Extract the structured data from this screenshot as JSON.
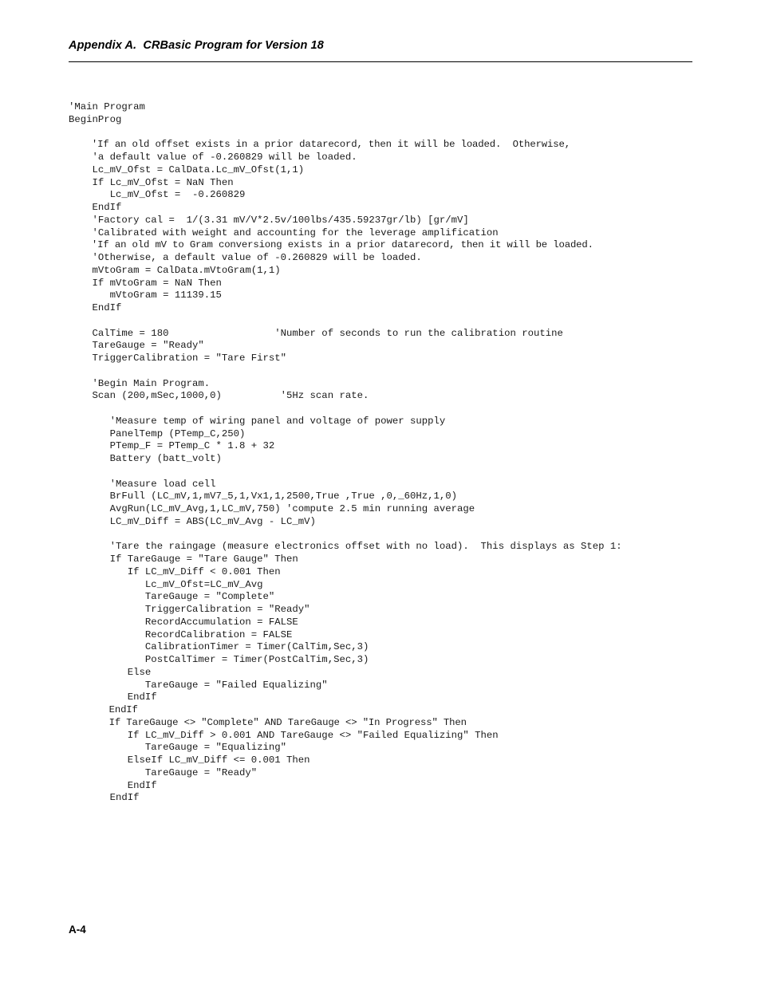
{
  "document": {
    "header": {
      "title": "Appendix A.  CRBasic Program for Version 18"
    },
    "footer": {
      "page_number": "A-4"
    },
    "code": {
      "language": "CRBasic",
      "lines": [
        "'Main Program",
        "BeginProg",
        "",
        "    'If an old offset exists in a prior datarecord, then it will be loaded.  Otherwise,",
        "    'a default value of -0.260829 will be loaded.",
        "    Lc_mV_Ofst = CalData.Lc_mV_Ofst(1,1)",
        "    If Lc_mV_Ofst = NaN Then",
        "       Lc_mV_Ofst =  -0.260829",
        "    EndIf",
        "    'Factory cal =  1/(3.31 mV/V*2.5v/100lbs/435.59237gr/lb) [gr/mV]",
        "    'Calibrated with weight and accounting for the leverage amplification",
        "    'If an old mV to Gram conversiong exists in a prior datarecord, then it will be loaded.",
        "    'Otherwise, a default value of -0.260829 will be loaded.",
        "    mVtoGram = CalData.mVtoGram(1,1)",
        "    If mVtoGram = NaN Then",
        "       mVtoGram = 11139.15",
        "    EndIf",
        "",
        "    CalTime = 180                  'Number of seconds to run the calibration routine",
        "    TareGauge = \"Ready\"",
        "    TriggerCalibration = \"Tare First\"",
        "",
        "    'Begin Main Program.",
        "    Scan (200,mSec,1000,0)          '5Hz scan rate.",
        "",
        "       'Measure temp of wiring panel and voltage of power supply",
        "       PanelTemp (PTemp_C,250)",
        "       PTemp_F = PTemp_C * 1.8 + 32",
        "       Battery (batt_volt)",
        "",
        "       'Measure load cell",
        "       BrFull (LC_mV,1,mV7_5,1,Vx1,1,2500,True ,True ,0,_60Hz,1,0)",
        "       AvgRun(LC_mV_Avg,1,LC_mV,750) 'compute 2.5 min running average",
        "       LC_mV_Diff = ABS(LC_mV_Avg - LC_mV)",
        "",
        "       'Tare the raingage (measure electronics offset with no load).  This displays as Step 1:",
        "       If TareGauge = \"Tare Gauge\" Then",
        "          If LC_mV_Diff < 0.001 Then",
        "             Lc_mV_Ofst=LC_mV_Avg",
        "             TareGauge = \"Complete\"",
        "             TriggerCalibration = \"Ready\"",
        "             RecordAccumulation = FALSE",
        "             RecordCalibration = FALSE",
        "             CalibrationTimer = Timer(CalTim,Sec,3)",
        "             PostCalTimer = Timer(PostCalTim,Sec,3)",
        "          Else",
        "             TareGauge = \"Failed Equalizing\"",
        "          EndIf",
        "       EndIf",
        "       If TareGauge <> \"Complete\" AND TareGauge <> \"In Progress\" Then",
        "          If LC_mV_Diff > 0.001 AND TareGauge <> \"Failed Equalizing\" Then",
        "             TareGauge = \"Equalizing\"",
        "          ElseIf LC_mV_Diff <= 0.001 Then",
        "             TareGauge = \"Ready\"",
        "          EndIf",
        "       EndIf"
      ],
      "tight_line_indexes": [
        3,
        11,
        34,
        48,
        49
      ]
    }
  }
}
